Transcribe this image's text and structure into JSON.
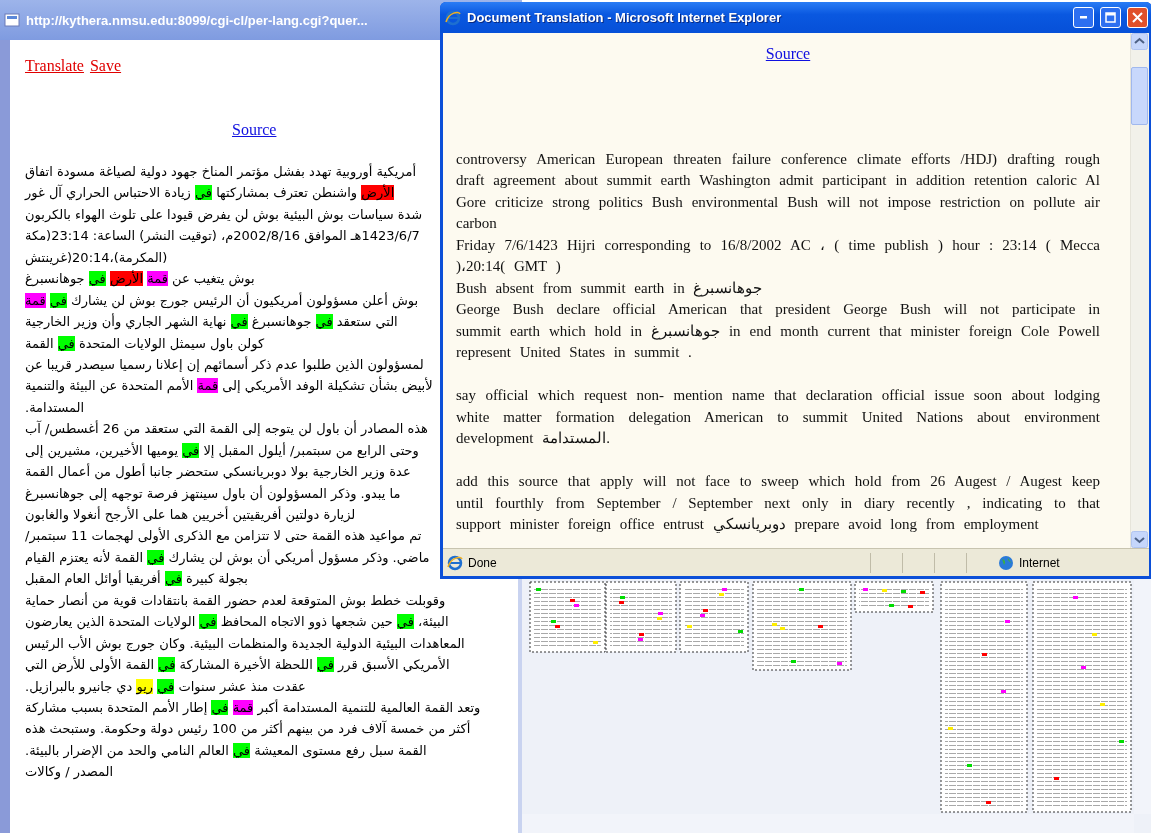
{
  "source_window": {
    "title": "http://kythera.nmsu.edu:8099/cgi-cl/per-lang.cgi?quer...",
    "translate_link": "Translate",
    "save_link": "Save",
    "source_link": "Source",
    "lines": [
      [
        {
          "text": "أمريكية أوروبية تهدد بفشل مؤتمر المناخ جهود دولية لصياغة مسودة اتفاق"
        }
      ],
      [
        {
          "text": "الأرض",
          "color": "#ff0000"
        },
        {
          "text": "واشنطن تعترف بمشاركتها"
        },
        {
          "text": "في",
          "color": "#00ff00"
        },
        {
          "text": "زيادة الاحتباس الحراري آل غور"
        }
      ],
      [
        {
          "text": "شدة سياسات بوش البيئية بوش لن يفرض قيودا على تلوث الهواء بالكربون"
        }
      ],
      [
        {
          "text": "1423/6/7هـ الموافق 2002/8/16م، (توقيت النشر) الساعة: 23:14(مكة"
        }
      ],
      [
        {
          "text": "(المكرمة)،20:14(غرينتش"
        }
      ],
      [
        {
          "text": "بوش يتغيب عن"
        },
        {
          "text": "قمة",
          "color": "#ff00ff"
        },
        {
          "text": "الأرض",
          "color": "#ff0000"
        },
        {
          "text": "في",
          "color": "#00ff00"
        },
        {
          "text": "جوهانسبرغ"
        }
      ],
      [
        {
          "text": "بوش أعلن مسؤولون أمريكيون أن الرئيس جورج بوش لن يشارك"
        },
        {
          "text": "في",
          "color": "#00ff00"
        },
        {
          "text": "قمة",
          "color": "#ff00ff"
        }
      ],
      [
        {
          "text": "التي ستعقد"
        },
        {
          "text": "في",
          "color": "#00ff00"
        },
        {
          "text": "جوهانسبرغ"
        },
        {
          "text": "في",
          "color": "#00ff00"
        },
        {
          "text": "نهاية الشهر الجاري وأن وزير الخارجية"
        }
      ],
      [
        {
          "text": "كولن باول سيمثل الولايات المتحدة"
        },
        {
          "text": "في",
          "color": "#00ff00"
        },
        {
          "text": "القمة"
        }
      ],
      [
        {
          "text": "لمسؤولون الذين طلبوا عدم ذكر أسمائهم إن إعلانا رسميا سيصدر قريبا عن"
        }
      ],
      [
        {
          "text": "لأبيض بشأن تشكيلة الوفد الأمريكي إلى"
        },
        {
          "text": "قمة",
          "color": "#ff00ff"
        },
        {
          "text": "الأمم المتحدة عن البيئة والتنمية"
        }
      ],
      [
        {
          "text": "المستدامة."
        }
      ],
      [
        {
          "text": "هذه المصادر أن باول لن يتوجه إلى القمة التي ستعقد من 26 أغسطس/ آب"
        }
      ],
      [
        {
          "text": "وحتى الرابع من سبتمبر/ أيلول المقبل إلا"
        },
        {
          "text": "في",
          "color": "#00ff00"
        },
        {
          "text": "يوميها الأخيرين، مشيرين إلى"
        }
      ],
      [
        {
          "text": "عدة وزير الخارجية بولا دوبريانسكي ستحضر جانبا أطول من أعمال القمة"
        }
      ],
      [
        {
          "text": "ما يبدو. وذكر المسؤولون أن باول سينتهز فرصة توجهه إلى جوهانسبرغ"
        }
      ],
      [
        {
          "text": "لزيارة دولتين أفريقيتين أخريين هما على الأرجح أنغولا والغابون"
        }
      ],
      [
        {
          "text": "تم مواعيد هذه القمة حتى لا تتزامن مع الذكرى الأولى لهجمات 11 سبتمبر/"
        }
      ],
      [
        {
          "text": "ماضي. وذكر مسؤول أمريكي أن بوش لن يشارك"
        },
        {
          "text": "في",
          "color": "#00ff00"
        },
        {
          "text": "القمة لأنه يعتزم القيام"
        }
      ],
      [
        {
          "text": "بجولة كبيرة"
        },
        {
          "text": "في",
          "color": "#00ff00"
        },
        {
          "text": "أفريقيا أوائل العام المقبل"
        }
      ],
      [
        {
          "text": "وقوبلت خطط بوش المتوقعة لعدم حضور القمة بانتقادات قوية من أنصار حماية"
        }
      ],
      [
        {
          "text": "البيئة،"
        },
        {
          "text": "في",
          "color": "#00ff00"
        },
        {
          "text": "حين شجعها ذوو الاتجاه المحافظ"
        },
        {
          "text": "في",
          "color": "#00ff00"
        },
        {
          "text": "الولايات المتحدة الذين يعارضون"
        }
      ],
      [
        {
          "text": "المعاهدات البيئية الدولية الجديدة والمنظمات البيئية. وكان جورج بوش الأب الرئيس"
        }
      ],
      [
        {
          "text": "الأمريكي الأسبق قرر"
        },
        {
          "text": "في",
          "color": "#00ff00"
        },
        {
          "text": "اللحظة الأخيرة المشاركة"
        },
        {
          "text": "في",
          "color": "#00ff00"
        },
        {
          "text": "القمة الأولى للأرض التي"
        }
      ],
      [
        {
          "text": "عقدت منذ عشر سنوات"
        },
        {
          "text": "في",
          "color": "#00ff00"
        },
        {
          "text": "ريو",
          "color": "#ffff00"
        },
        {
          "text": "دي جانيرو بالبرازيل."
        }
      ],
      [
        {
          "text": "وتعد القمة العالمية للتنمية المستدامة أكبر"
        },
        {
          "text": "قمة",
          "color": "#ff00ff"
        },
        {
          "text": "في",
          "color": "#00ff00"
        },
        {
          "text": "إطار الأمم المتحدة بسبب مشاركة"
        }
      ],
      [
        {
          "text": "أكثر من خمسة آلاف فرد من بينهم أكثر من 100 رئيس دولة وحكومة. وستبحث هذه"
        }
      ],
      [
        {
          "text": "القمة سبل رفع مستوى المعيشة"
        },
        {
          "text": "في",
          "color": "#00ff00"
        },
        {
          "text": "العالم النامي والحد من الإضرار بالبيئة."
        }
      ],
      [
        {
          "text": "المصدر / وكالات"
        }
      ]
    ]
  },
  "translation_window": {
    "title": "Document Translation - Microsoft Internet Explorer",
    "source_link": "Source",
    "blocks": [
      [
        "controversy American European threaten failure conference climate efforts /HDJ) drafting rough draft agreement about summit earth Washington admit participant in addition retention caloric Al Gore criticize strong politics Bush environmental Bush will not impose restriction on pollute air carbon",
        "Friday 7/6/1423 Hijri corresponding to 16/8/2002 AC ، ( time publish ) hour : 23:14 ( Mecca )،20:14( GMT )",
        "Bush absent from summit earth in جوهانسبرغ",
        "George Bush declare official American that president George Bush will not participate in summit earth which hold in جوهانسبرغ in end month current that minister foreign Cole Powell represent United States in summit ."
      ],
      [
        "say official which request non- mention name that declaration official issue soon about lodging white matter formation delegation American to summit United Nations about environment development المستدامة."
      ],
      [
        "add this source that apply will not face to sweep which hold from 26 Augest / Augest keep until fourthly from September / September next only in diary recently , indicating to that support minister foreign office entrust دوبريانسكي prepare avoid long from employment"
      ]
    ],
    "status": "Done",
    "zone": "Internet"
  }
}
